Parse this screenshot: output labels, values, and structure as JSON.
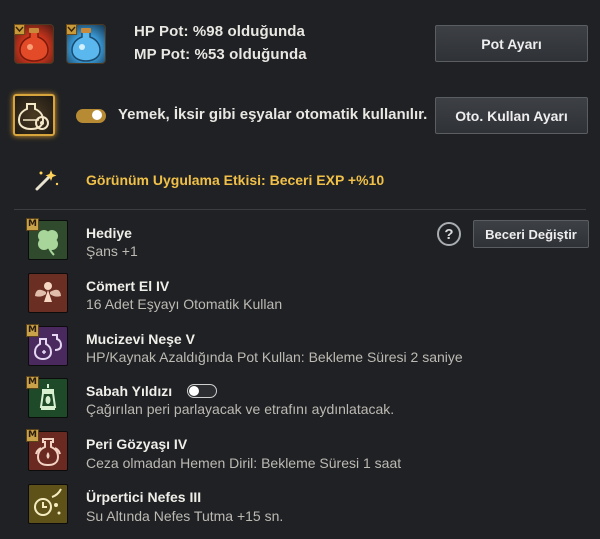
{
  "potions": {
    "hp_text": "HP Pot: %98 olduğunda",
    "mp_text": "MP Pot: %53 olduğunda",
    "button_label": "Pot Ayarı",
    "hp_icon": "hp-potion-icon",
    "mp_icon": "mp-potion-icon"
  },
  "auto_use": {
    "toggle_on": true,
    "text": "Yemek, İksir gibi eşyalar otomatik kullanılır.",
    "button_label": "Oto. Kullan Ayarı",
    "icon": "auto-use-potion-gear-icon"
  },
  "appearance": {
    "text": "Görünüm Uygulama Etkisi: Beceri EXP +%10",
    "icon": "magic-wand-icon",
    "color": "#f0c048"
  },
  "skills_header": {
    "button_label": "Beceri Değiştir",
    "help_label": "?"
  },
  "skills": [
    {
      "name": "Hediye",
      "desc": "Şans +1",
      "mastery": "M",
      "icon": "clover-icon"
    },
    {
      "name": "Cömert El IV",
      "desc": "16 Adet Eşyayı Otomatik Kullan",
      "mastery": "",
      "icon": "fairy-icon"
    },
    {
      "name": "Mucizevi Neşe V",
      "desc": "HP/Kaynak Azaldığında Pot Kullan: Bekleme Süresi 2 saniye",
      "mastery": "M",
      "icon": "potion-bottles-icon"
    },
    {
      "name": "Sabah Yıldızı",
      "desc": "Çağırılan peri parlayacak ve etrafını aydınlatacak.",
      "mastery": "M",
      "icon": "lantern-icon",
      "toggle_on": false
    },
    {
      "name": "Peri Gözyaşı IV",
      "desc": "Ceza olmadan Hemen Diril: Bekleme Süresi 1 saat",
      "mastery": "M",
      "icon": "revive-flask-icon"
    },
    {
      "name": "Ürpertici Nefes III",
      "desc": "Su Altında Nefes Tutma +15 sn.",
      "mastery": "",
      "icon": "bubble-breath-icon"
    }
  ]
}
